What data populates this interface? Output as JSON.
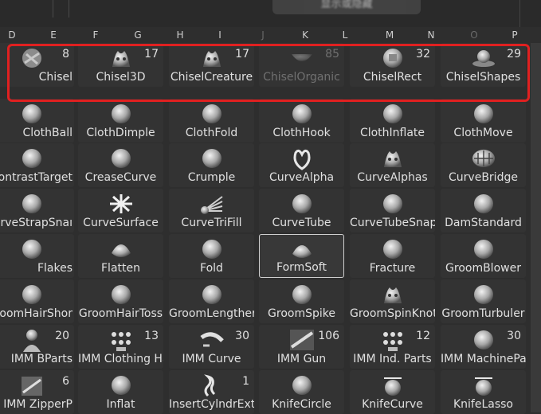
{
  "tooltip": "显示或隐藏",
  "columns": [
    "D",
    "E",
    "F",
    "G",
    "H",
    "I",
    "J",
    "K",
    "L",
    "M",
    "N",
    "O",
    "P"
  ],
  "rows": [
    [
      {
        "name": "Chisel",
        "count": "8",
        "icon": "chisel-icon"
      },
      {
        "name": "Chisel3D",
        "count": "17",
        "icon": "chisel3d-icon"
      },
      {
        "name": "ChiselCreature",
        "count": "17",
        "icon": "chisel-creature-icon"
      },
      {
        "name": "ChiselOrganic",
        "count": "85",
        "icon": "chisel-organic-icon",
        "dimmed": true
      },
      {
        "name": "ChiselRect",
        "count": "32",
        "icon": "chisel-rect-icon"
      },
      {
        "name": "ChiselShapes",
        "count": "29",
        "icon": "chisel-shapes-icon"
      }
    ],
    [
      {
        "name": "ClothBall",
        "icon": "cloth-ball-icon"
      },
      {
        "name": "ClothDimple",
        "icon": "cloth-dimple-icon"
      },
      {
        "name": "ClothFold",
        "icon": "cloth-fold-icon"
      },
      {
        "name": "ClothHook",
        "icon": "cloth-hook-icon"
      },
      {
        "name": "ClothInflate",
        "icon": "cloth-inflate-icon"
      },
      {
        "name": "ClothMove",
        "icon": "cloth-move-icon"
      }
    ],
    [
      {
        "name": "ontrastTarget",
        "icon": "contrast-target-icon"
      },
      {
        "name": "CreaseCurve",
        "icon": "crease-curve-icon"
      },
      {
        "name": "Crumple",
        "icon": "crumple-icon"
      },
      {
        "name": "CurveAlpha",
        "icon": "curve-alpha-icon"
      },
      {
        "name": "CurveAlphas",
        "icon": "curve-alphas-icon"
      },
      {
        "name": "CurveBridge",
        "icon": "curve-bridge-icon"
      }
    ],
    [
      {
        "name": "urveStrapSnaı",
        "icon": "curve-strap-snap-icon"
      },
      {
        "name": "CurveSurface",
        "icon": "curve-surface-icon"
      },
      {
        "name": "CurveTriFill",
        "icon": "curve-trifill-icon"
      },
      {
        "name": "CurveTube",
        "icon": "curve-tube-icon"
      },
      {
        "name": "CurveTubeSnap",
        "icon": "curve-tube-snap-icon"
      },
      {
        "name": "DamStandard",
        "icon": "dam-standard-icon"
      }
    ],
    [
      {
        "name": "Flakes",
        "icon": "flakes-icon"
      },
      {
        "name": "Flatten",
        "icon": "flatten-icon"
      },
      {
        "name": "Fold",
        "icon": "fold-icon"
      },
      {
        "name": "FormSoft",
        "icon": "form-soft-icon",
        "selected": true
      },
      {
        "name": "Fracture",
        "icon": "fracture-icon"
      },
      {
        "name": "GroomBlower",
        "icon": "groom-blower-icon"
      }
    ],
    [
      {
        "name": "oomHairShor",
        "icon": "groom-hair-short-icon"
      },
      {
        "name": "GroomHairToss",
        "icon": "groom-hair-toss-icon"
      },
      {
        "name": "GroomLengther",
        "icon": "groom-lengthen-icon"
      },
      {
        "name": "GroomSpike",
        "icon": "groom-spike-icon"
      },
      {
        "name": "GroomSpinKnot",
        "icon": "groom-spin-knot-icon"
      },
      {
        "name": "GroomTurbuler",
        "icon": "groom-turbulence-icon"
      }
    ],
    [
      {
        "name": "IMM BParts",
        "count": "20",
        "icon": "imm-bparts-icon"
      },
      {
        "name": "IMM Clothing Ha",
        "count": "13",
        "icon": "imm-clothing-icon"
      },
      {
        "name": "IMM Curve",
        "count": "30",
        "icon": "imm-curve-icon"
      },
      {
        "name": "IMM Gun",
        "count": "106",
        "icon": "imm-gun-icon"
      },
      {
        "name": "IMM Ind. Parts",
        "count": "12",
        "icon": "imm-ind-parts-icon"
      },
      {
        "name": "IMM MachinePa",
        "count": "30",
        "icon": "imm-machine-parts-icon"
      }
    ],
    [
      {
        "name": "IMM ZipperP",
        "count": "6",
        "icon": "imm-zipper-icon"
      },
      {
        "name": "Inflat",
        "icon": "inflat-icon"
      },
      {
        "name": "InsertCylndrExt",
        "count": "1",
        "icon": "insert-cylinder-icon"
      },
      {
        "name": "KnifeCircle",
        "icon": "knife-circle-icon"
      },
      {
        "name": "KnifeCurve",
        "icon": "knife-curve-icon"
      },
      {
        "name": "KnifeLasso",
        "icon": "knife-lasso-icon"
      }
    ]
  ]
}
